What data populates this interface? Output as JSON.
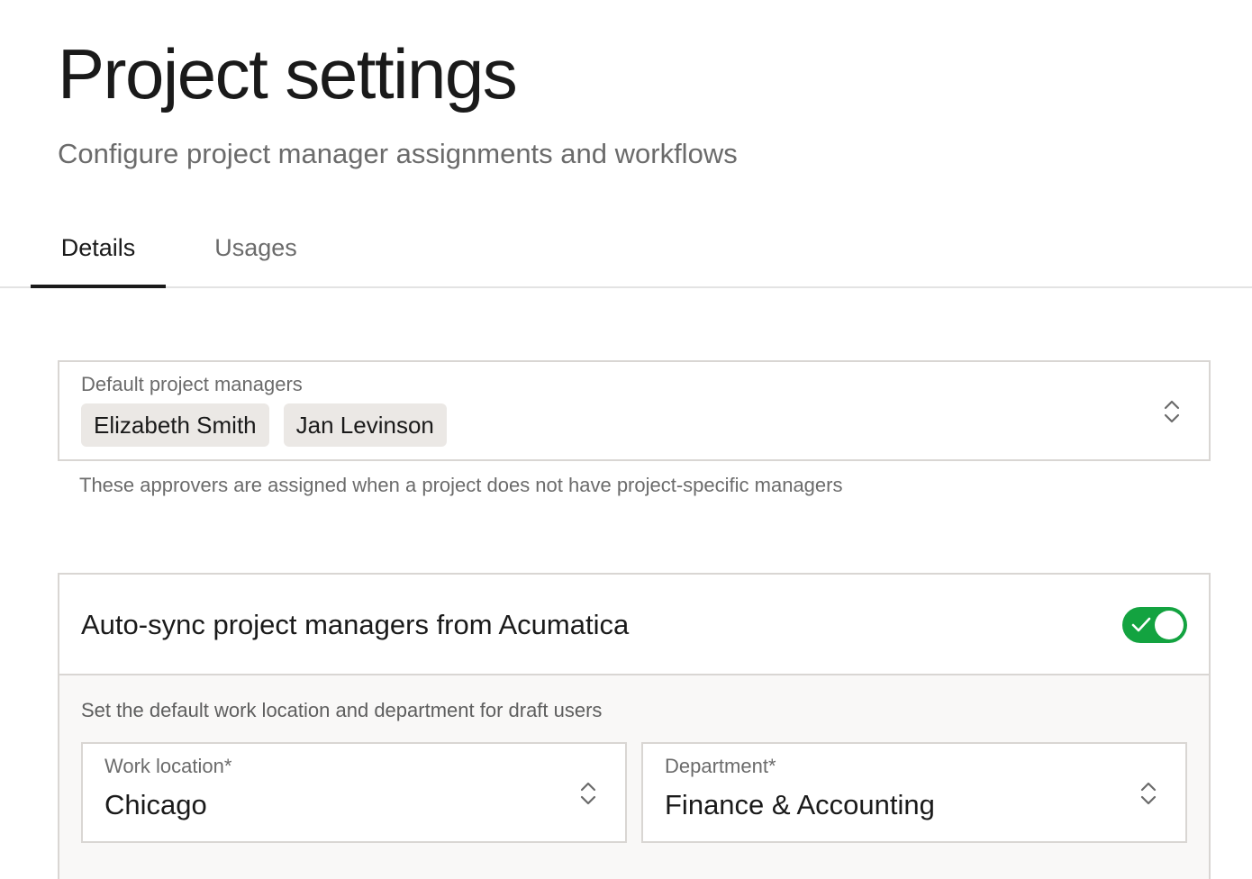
{
  "page": {
    "title": "Project settings",
    "subtitle": "Configure project manager assignments and workflows"
  },
  "tabs": [
    {
      "label": "Details",
      "active": true
    },
    {
      "label": "Usages",
      "active": false
    }
  ],
  "default_managers": {
    "label": "Default project managers",
    "chips": [
      "Elizabeth Smith",
      "Jan Levinson"
    ],
    "helper": "These approvers are assigned when a project does not have project-specific managers"
  },
  "auto_sync": {
    "title": "Auto-sync project managers from Acumatica",
    "enabled": true,
    "description": "Set the default work location and department for draft users",
    "work_location": {
      "label": "Work location*",
      "value": "Chicago"
    },
    "department": {
      "label": "Department*",
      "value": "Finance & Accounting"
    }
  },
  "colors": {
    "toggle_on": "#13a340",
    "chip_bg": "#ebe8e5",
    "border": "#d9d6d3"
  },
  "icons": {
    "select_chevron": "chevron-up-down-icon",
    "toggle_check": "check-icon"
  }
}
